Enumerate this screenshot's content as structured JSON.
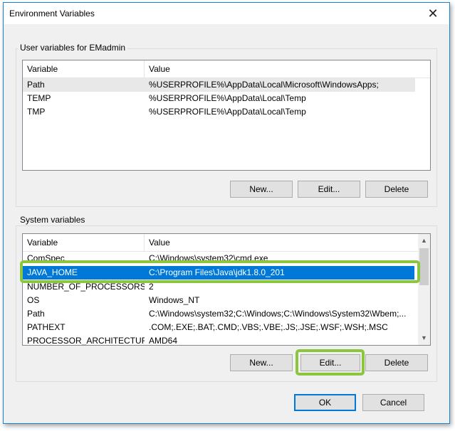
{
  "window": {
    "title": "Environment Variables",
    "close_glyph": "✕"
  },
  "user_group": {
    "label": "User variables for EMadmin",
    "columns": [
      "Variable",
      "Value"
    ],
    "rows": [
      {
        "variable": "Path",
        "value": "%USERPROFILE%\\AppData\\Local\\Microsoft\\WindowsApps;"
      },
      {
        "variable": "TEMP",
        "value": "%USERPROFILE%\\AppData\\Local\\Temp"
      },
      {
        "variable": "TMP",
        "value": "%USERPROFILE%\\AppData\\Local\\Temp"
      }
    ],
    "buttons": {
      "new": "New...",
      "edit": "Edit...",
      "delete": "Delete"
    }
  },
  "system_group": {
    "label": "System variables",
    "columns": [
      "Variable",
      "Value"
    ],
    "rows": [
      {
        "variable": "ComSpec",
        "value": "C:\\Windows\\system32\\cmd.exe"
      },
      {
        "variable": "JAVA_HOME",
        "value": "C:\\Program Files\\Java\\jdk1.8.0_201"
      },
      {
        "variable": "NUMBER_OF_PROCESSORS",
        "value": "2"
      },
      {
        "variable": "OS",
        "value": "Windows_NT"
      },
      {
        "variable": "Path",
        "value": "C:\\Windows\\system32;C:\\Windows;C:\\Windows\\System32\\Wbem;..."
      },
      {
        "variable": "PATHEXT",
        "value": ".COM;.EXE;.BAT;.CMD;.VBS;.VBE;.JS;.JSE;.WSF;.WSH;.MSC"
      },
      {
        "variable": "PROCESSOR_ARCHITECTURE",
        "value": "AMD64"
      }
    ],
    "buttons": {
      "new": "New...",
      "edit": "Edit...",
      "delete": "Delete"
    }
  },
  "footer": {
    "ok": "OK",
    "cancel": "Cancel"
  },
  "colors": {
    "highlight": "#8cc63f",
    "selection": "#0078d7",
    "accent": "#1883d7"
  }
}
